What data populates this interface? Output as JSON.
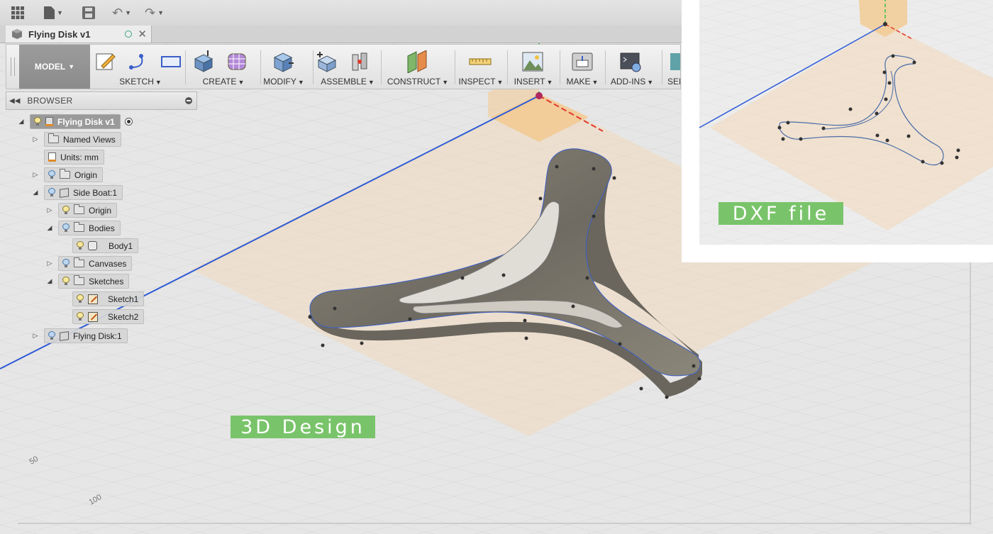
{
  "window": {
    "document_tab": {
      "title": "Flying Disk v1"
    }
  },
  "ribbon": {
    "workspace": "MODEL",
    "groups": [
      {
        "label": "SKETCH"
      },
      {
        "label": "CREATE"
      },
      {
        "label": "MODIFY"
      },
      {
        "label": "ASSEMBLE"
      },
      {
        "label": "CONSTRUCT"
      },
      {
        "label": "INSPECT"
      },
      {
        "label": "INSERT"
      },
      {
        "label": "MAKE"
      },
      {
        "label": "ADD-INS"
      },
      {
        "label": "SEL"
      }
    ]
  },
  "browser": {
    "title": "BROWSER",
    "tree": [
      {
        "label": "Flying Disk v1"
      },
      {
        "label": "Named Views"
      },
      {
        "label": "Units: mm"
      },
      {
        "label": "Origin"
      },
      {
        "label": "Side Boat:1"
      },
      {
        "label": "Origin"
      },
      {
        "label": "Bodies"
      },
      {
        "label": "Body1"
      },
      {
        "label": "Canvases"
      },
      {
        "label": "Sketches"
      },
      {
        "label": "Sketch1"
      },
      {
        "label": "Sketch2"
      },
      {
        "label": "Flying Disk:1"
      }
    ]
  },
  "viewport": {
    "ruler_labels": [
      "50",
      "100"
    ],
    "callout_3d": "3D Design"
  },
  "inset": {
    "callout": "DXF file"
  },
  "colors": {
    "model_bar": "#8f8f8f",
    "callout_green": "#79c46a",
    "axis_blue": "#2e5bd6",
    "axis_red": "#e03a2e",
    "axis_green": "#39c24a",
    "plane_orange": "#f3c98f",
    "part_metal": "#7b776c"
  },
  "icons": [
    "grid-menu-icon",
    "file-icon",
    "save-icon",
    "undo-icon",
    "redo-icon",
    "close-icon",
    "light-bulb-icon",
    "folder-icon",
    "component-icon",
    "document-icon",
    "body-icon",
    "sketch-icon"
  ]
}
